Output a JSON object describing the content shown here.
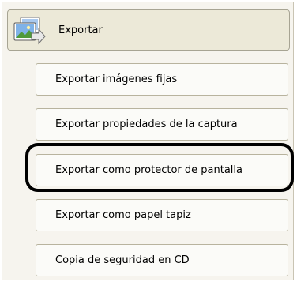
{
  "header": {
    "label": "Exportar",
    "icon": "export-images-icon"
  },
  "menu": {
    "items": [
      {
        "label": "Exportar imágenes fijas"
      },
      {
        "label": "Exportar propiedades de la captura"
      },
      {
        "label": "Exportar como protector de pantalla",
        "highlighted": true
      },
      {
        "label": "Exportar como papel tapiz"
      },
      {
        "label": "Copia de seguridad en CD"
      }
    ]
  },
  "colors": {
    "panel_bg": "#f6f4ee",
    "header_bg": "#ece9d8",
    "item_bg": "#fbfbf8",
    "item_border": "#b8b39e",
    "highlight": "#000000"
  }
}
